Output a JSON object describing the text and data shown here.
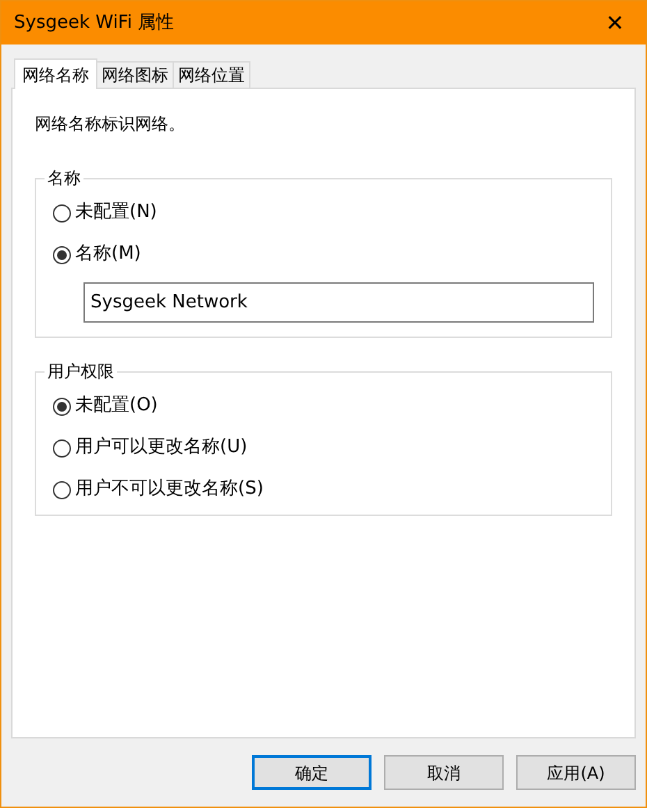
{
  "window": {
    "title": "Sysgeek WiFi 属性",
    "close": "✕"
  },
  "tabs": [
    {
      "label": "网络名称",
      "selected": true
    },
    {
      "label": "网络图标",
      "selected": false
    },
    {
      "label": "网络位置",
      "selected": false
    }
  ],
  "description": "网络名称标识网络。",
  "groups": [
    {
      "title": "名称",
      "options": [
        {
          "label": "未配置(N)",
          "selected": false
        },
        {
          "label": "名称(M)",
          "selected": true
        }
      ],
      "field": {
        "value": "Sysgeek Network"
      }
    },
    {
      "title": "用户权限",
      "options": [
        {
          "label": "未配置(O)",
          "selected": true
        },
        {
          "label": "用户可以更改名称(U)",
          "selected": false
        },
        {
          "label": "用户不可以更改名称(S)",
          "selected": false
        }
      ]
    }
  ],
  "buttons": [
    {
      "label": "确定",
      "default": true
    },
    {
      "label": "取消",
      "default": false
    },
    {
      "label": "应用(A)",
      "default": false
    }
  ]
}
